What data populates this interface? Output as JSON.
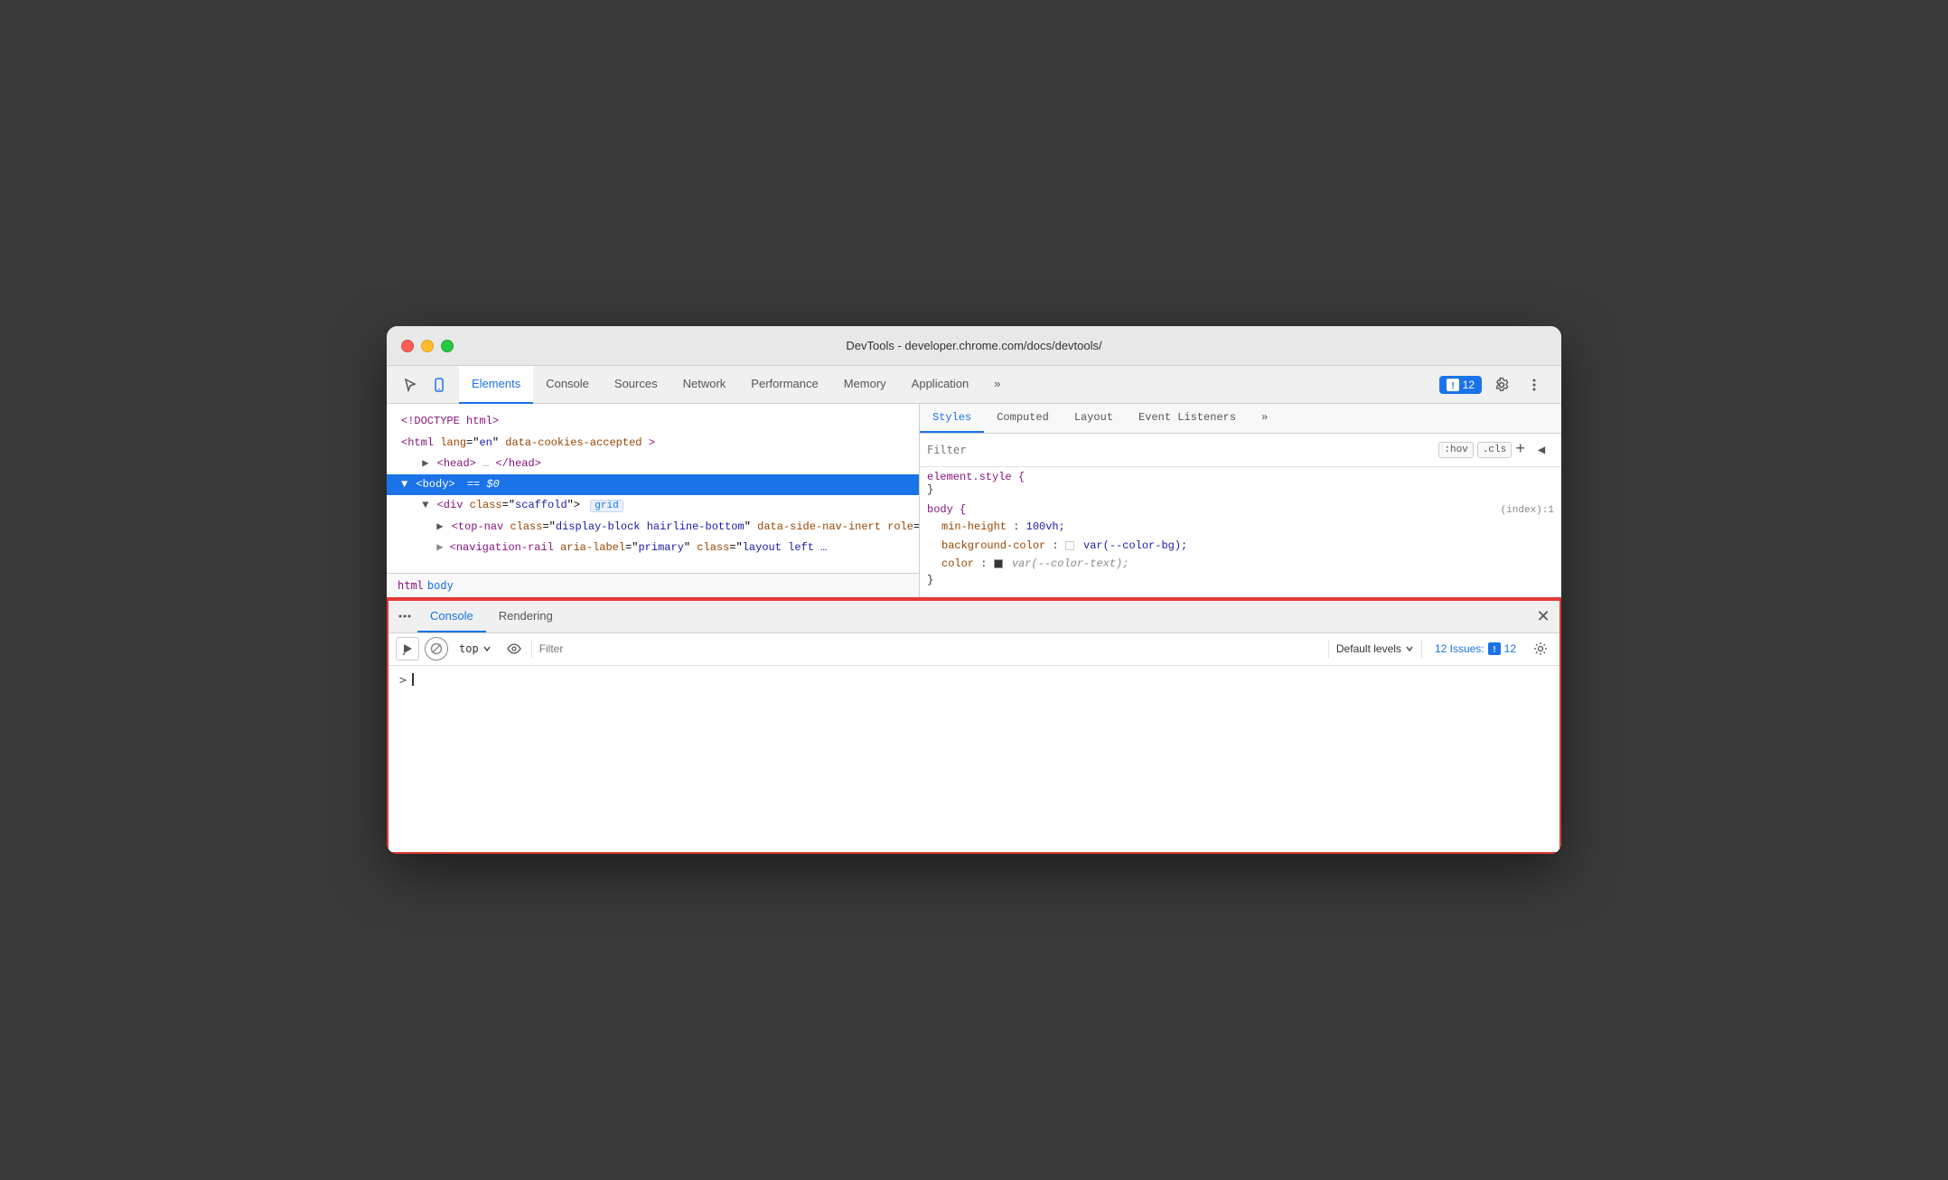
{
  "window": {
    "title": "DevTools - developer.chrome.com/docs/devtools/"
  },
  "traffic_lights": {
    "red_label": "close",
    "yellow_label": "minimize",
    "green_label": "maximize"
  },
  "devtools_tabs": {
    "icons": [
      "cursor-icon",
      "mobile-icon"
    ],
    "tabs": [
      {
        "label": "Elements",
        "active": true
      },
      {
        "label": "Console",
        "active": false
      },
      {
        "label": "Sources",
        "active": false
      },
      {
        "label": "Network",
        "active": false
      },
      {
        "label": "Performance",
        "active": false
      },
      {
        "label": "Memory",
        "active": false
      },
      {
        "label": "Application",
        "active": false
      },
      {
        "label": "»",
        "active": false
      }
    ],
    "issues_count": "12",
    "issues_label": "12"
  },
  "dom_panel": {
    "lines": [
      {
        "text": "<!DOCTYPE html>",
        "type": "doctype",
        "indent": 0
      },
      {
        "text": "<html lang=\"en\" data-cookies-accepted>",
        "type": "element",
        "indent": 0
      },
      {
        "text": "▶<head>…</head>",
        "type": "element",
        "indent": 1
      },
      {
        "text": "▼<body> == $0",
        "type": "element-selected",
        "indent": 0
      },
      {
        "text": "▼<div class=\"scaffold\">",
        "type": "element",
        "indent": 1,
        "badge": "grid"
      },
      {
        "text": "▶<top-nav class=\"display-block hairline-bottom\" data-side-nav-inert role=\"banner\">…</top-nav>",
        "type": "element",
        "indent": 2
      },
      {
        "text": "▶<navigation-rail aria-label=\"primary\" class=\"layout left …",
        "type": "element-truncated",
        "indent": 2
      }
    ]
  },
  "breadcrumb": {
    "items": [
      "html",
      "body"
    ]
  },
  "styles_panel": {
    "tabs": [
      {
        "label": "Styles",
        "active": true
      },
      {
        "label": "Computed",
        "active": false
      },
      {
        "label": "Layout",
        "active": false
      },
      {
        "label": "Event Listeners",
        "active": false
      },
      {
        "label": "»",
        "active": false
      }
    ],
    "filter_placeholder": "Filter",
    "filter_actions": [
      ":hov",
      ".cls",
      "+",
      "◀"
    ],
    "rules": [
      {
        "selector": "element.style {",
        "closing": "}",
        "properties": []
      },
      {
        "selector": "body {",
        "source": "(index):1",
        "closing": "}",
        "properties": [
          {
            "name": "min-height",
            "value": "100vh;"
          },
          {
            "name": "background-color",
            "value": "var(--color-bg);",
            "has_swatch": true,
            "swatch_color": "#ffffff"
          },
          {
            "name": "color",
            "value": "var(--color-text);",
            "has_swatch": true,
            "swatch_color": "#333333",
            "truncated": true
          }
        ]
      }
    ]
  },
  "bottom_panel": {
    "tabs": [
      {
        "label": "Console",
        "active": true
      },
      {
        "label": "Rendering",
        "active": false
      }
    ],
    "toolbar": {
      "top_label": "top",
      "filter_placeholder": "Filter",
      "default_levels": "Default levels",
      "issues_label": "12 Issues:",
      "issues_count": "12"
    },
    "console_input": {
      "prompt": ">",
      "value": ""
    }
  }
}
